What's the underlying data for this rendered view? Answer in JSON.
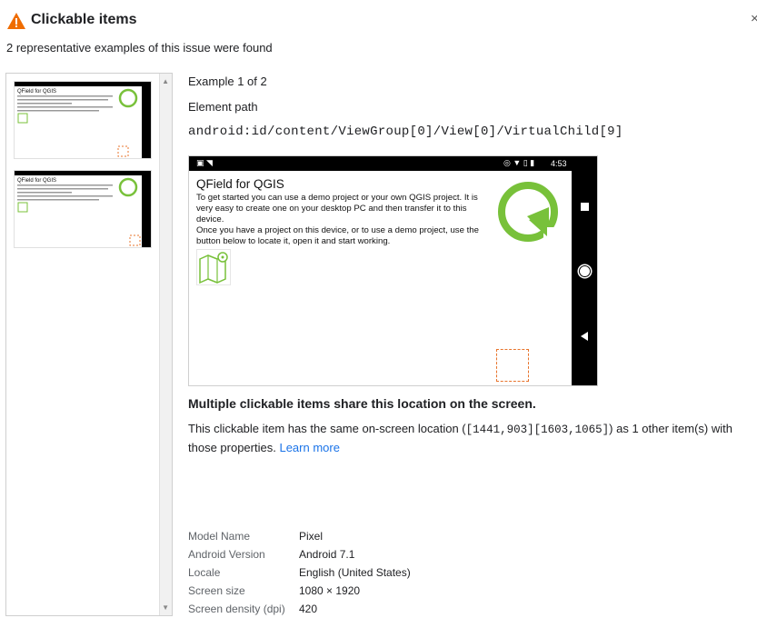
{
  "panel": {
    "title": "Clickable items",
    "summary": "2 representative examples of this issue were found",
    "close_label": "×"
  },
  "example": {
    "counter": "Example 1 of 2",
    "element_path_label": "Element path",
    "element_path": "android:id/content/ViewGroup[0]/View[0]/VirtualChild[9]"
  },
  "device_screen": {
    "status_time": "4:53",
    "app_title": "QField for QGIS",
    "app_text_1": "To get started you can use a demo project or your own QGIS project. It is very easy to create one on your desktop PC and then transfer it to this device.",
    "app_text_2": "Once you have a project on this device, or to use a demo project, use the button below to locate it, open it and start working."
  },
  "issue": {
    "heading": "Multiple clickable items share this location on the screen.",
    "desc_prefix": "This clickable item has the same on-screen location (",
    "bounds": "[1441,903][1603,1065]",
    "desc_suffix": ") as 1 other item(s) with those properties.",
    "learn_more": "Learn more"
  },
  "device_props": [
    {
      "key": "Model Name",
      "value": "Pixel"
    },
    {
      "key": "Android Version",
      "value": "Android 7.1"
    },
    {
      "key": "Locale",
      "value": "English (United States)"
    },
    {
      "key": "Screen size",
      "value": "1080 × 1920"
    },
    {
      "key": "Screen density (dpi)",
      "value": "420"
    }
  ],
  "colors": {
    "warning": "#ef6c00",
    "link": "#1a73e8",
    "qgis_green": "#78c13a",
    "highlight": "#e8742c"
  },
  "icons": [
    "warning-icon",
    "close-icon",
    "qgis-logo-icon",
    "map-pin-icon",
    "square-nav-icon",
    "circle-nav-icon",
    "back-nav-icon"
  ]
}
